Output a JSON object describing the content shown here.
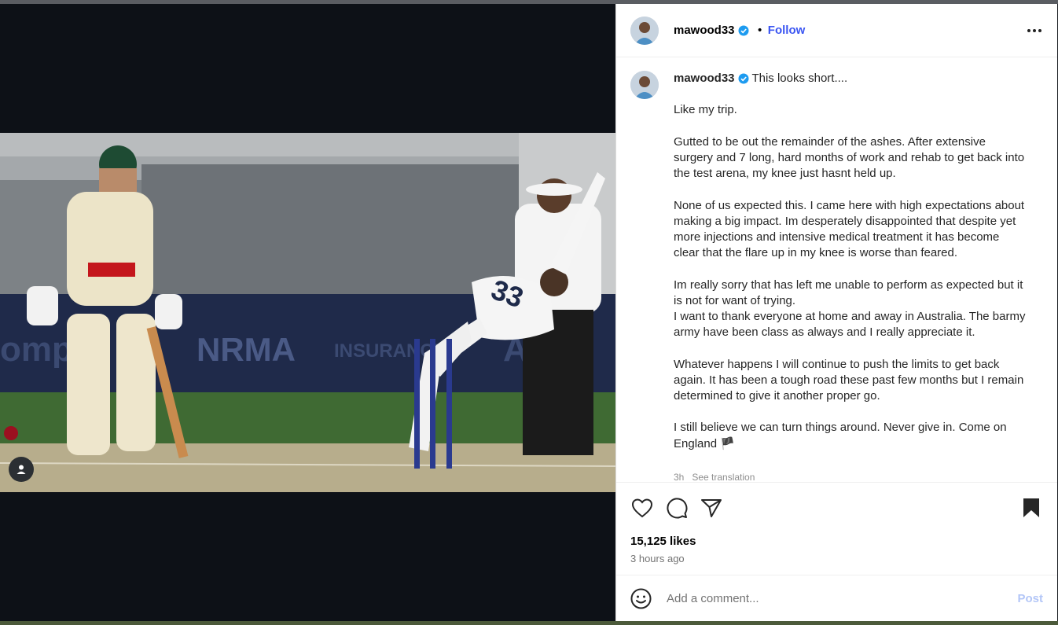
{
  "post": {
    "username": "mawood33",
    "follow_label": "Follow",
    "dot_separator": "•",
    "verified_icon": "verified-badge-icon",
    "caption_first_line": "This looks short....",
    "caption_body": "\n\nLike my trip.\n\nGutted to be out the remainder of the ashes. After extensive surgery and 7 long, hard months of work and rehab to get back into the test arena, my knee just hasnt held up.\n\nNone of us expected this. I came here with high expectations about making a big impact. Im desperately disappointed that despite yet more injections and intensive medical treatment it has become clear that the flare up in my knee is worse than feared.\n\nIm really sorry that has left me unable to perform as expected but it is not for want of trying.\nI want to thank everyone at home and away in Australia. The barmy army have been class as always and I really appreciate it.\n\nWhatever happens I will continue to push the limits to get back again. It has been a tough road these past few months but I remain determined to give it another proper go.\n\nI still believe we can turn things around. Never give in. Come on England 🏴",
    "caption_meta": "3h   See translation",
    "likes": "15,125 likes",
    "time_ago": "3 hours ago"
  },
  "comment": {
    "placeholder": "Add a comment...",
    "post_label": "Post"
  },
  "colors": {
    "follow": "#3a55f2",
    "verified": "#1d9bf0",
    "post_disabled": "#b3c6f7"
  }
}
